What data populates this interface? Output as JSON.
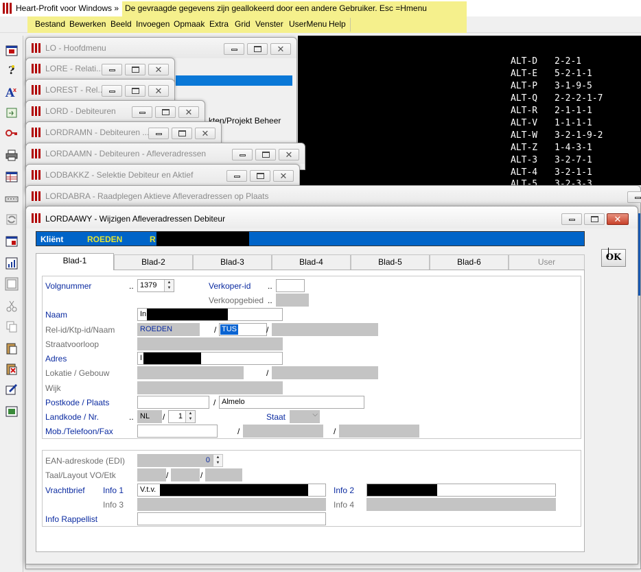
{
  "app": {
    "title": "Heart-Profit voor Windows",
    "arrow": "»",
    "status_message": "De gevraagde gegevens zijn geallokeerd door een andere Gebruiker.  Esc  =Hmenu"
  },
  "menu": {
    "items": [
      {
        "label": "Bestand"
      },
      {
        "label": "Bewerken"
      },
      {
        "label": "Beeld"
      },
      {
        "label": "Invoegen"
      },
      {
        "label": "Opmaak"
      },
      {
        "label": "Extra"
      },
      {
        "label": "Grid"
      },
      {
        "label": "Venster"
      },
      {
        "label": "UserMenu"
      },
      {
        "label": "Help"
      }
    ]
  },
  "toolbar": {
    "icons": [
      "window-exit-icon",
      "help-icon",
      "spellcheck-icon",
      "import-icon",
      "key-icon",
      "print-icon",
      "grid-window-icon",
      "keyboard-icon",
      "refresh-icon",
      "record-window-icon",
      "chart-icon",
      "panel-icon",
      "cut-icon",
      "copy-icon",
      "paste-icon",
      "delete-icon",
      "edit-icon",
      "image-icon"
    ]
  },
  "terminal": {
    "rows": [
      {
        "key": "ALT-D",
        "value": "2-2-1"
      },
      {
        "key": "ALT-E",
        "value": "5-2-1-1"
      },
      {
        "key": "ALT-P",
        "value": "3-1-9-5"
      },
      {
        "key": "ALT-Q",
        "value": "2-2-2-1-7"
      },
      {
        "key": "ALT-R",
        "value": "2-1-1-1"
      },
      {
        "key": "ALT-V",
        "value": "1-1-1-1"
      },
      {
        "key": "ALT-W",
        "value": "3-2-1-9-2"
      },
      {
        "key": "ALT-Z",
        "value": "1-4-3-1"
      },
      {
        "key": "ALT-3",
        "value": "3-2-7-1"
      },
      {
        "key": "ALT-4",
        "value": "3-2-1-1"
      },
      {
        "key": "ALT-5",
        "value": "3-2-3-3"
      }
    ]
  },
  "windows": {
    "lo": {
      "title": "LO - Hoofdmenu",
      "partial_text": "kten/Projekt Beheer"
    },
    "lore": {
      "title": "LORE - Relati..."
    },
    "lorest": {
      "title": "LOREST - Rel..."
    },
    "lord": {
      "title": "LORD - Debiteuren"
    },
    "lordramn": {
      "title": "LORDRAMN - Debiteuren ..."
    },
    "lordaamn": {
      "title": "LORDAAMN - Debiteuren - Afleveradressen"
    },
    "lodbakkz": {
      "title": "LODBAKKZ - Selektie Debiteur en Aktief"
    },
    "lordabra": {
      "title": "LORDABRA - Raadplegen Aktieve Afleveradressen op Plaats"
    }
  },
  "dialog": {
    "title": "LORDAAWY - Wijzigen Afleveradressen Debiteur",
    "client_label": "Kliënt",
    "client_value": "ROEDEN",
    "client_value_2": "R",
    "ok_label": "OK",
    "tabs": [
      {
        "label": "Blad-1"
      },
      {
        "label": "Blad-2"
      },
      {
        "label": "Blad-3"
      },
      {
        "label": "Blad-4"
      },
      {
        "label": "Blad-5"
      },
      {
        "label": "Blad-6"
      },
      {
        "label": "User"
      }
    ],
    "fields": {
      "volgnummer_label": "Volgnummer",
      "volgnummer_dots": "..",
      "volgnummer_value": "1379",
      "verkoper_label": "Verkoper-id",
      "verkoper_dots": "..",
      "verkoopgebied_label": "Verkoopgebied",
      "verkoopgebied_dots": "..",
      "naam_label": "Naam",
      "naam_value": "In",
      "relid_label": "Rel-id/Ktp-id/Naam",
      "relid_value": "ROEDEN",
      "ktp_value": "TUS",
      "slash": "/",
      "straat_label": "Straatvoorloop",
      "adres_label": "Adres",
      "adres_value": "I",
      "lokatie_label": "Lokatie / Gebouw",
      "wijk_label": "Wijk",
      "postkode_label": "Postkode / Plaats",
      "plaats_value": "Almelo",
      "landkode_label": "Landkode  / Nr.",
      "landkode_dots": "..",
      "landkode_value": "NL",
      "landkode_nr": "1",
      "staat_label": "Staat",
      "mob_label": "Mob./Telefoon/Fax",
      "ean_label": "EAN-adreskode (EDI)",
      "ean_value": "0",
      "taal_label": "Taal/Layout VO/Etk",
      "vrachtbrief_label": "Vrachtbrief",
      "info1_label": "Info 1",
      "info1_value": "V.t.v.",
      "info2_label": "Info 2",
      "info3_label": "Info 3",
      "info4_label": "Info 4",
      "rappellist_label": "Info Rappellist"
    }
  }
}
